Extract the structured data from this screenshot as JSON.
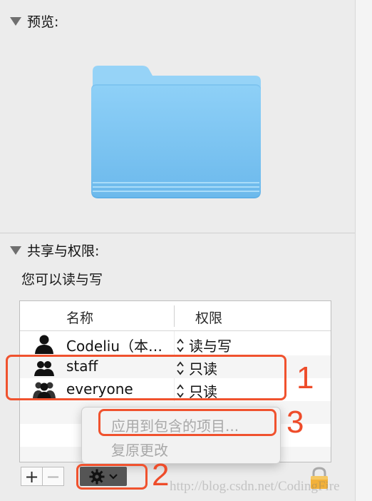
{
  "preview": {
    "header": "预览:"
  },
  "sharing": {
    "header": "共享与权限:",
    "status": "您可以读与写",
    "columns": {
      "name": "名称",
      "permission": "权限"
    },
    "rows": [
      {
        "name": "Codeliu（本…",
        "permission": "读与写",
        "icon": "user-icon"
      },
      {
        "name": "staff",
        "permission": "只读",
        "icon": "group-icon"
      },
      {
        "name": "everyone",
        "permission": "只读",
        "icon": "everyone-icon"
      }
    ]
  },
  "context_menu": {
    "items": [
      {
        "label": "应用到包含的项目...",
        "enabled": false
      },
      {
        "label": "复原更改",
        "enabled": false
      }
    ]
  },
  "toolbar": {
    "add_label": "+",
    "remove_label": "−"
  },
  "annotations": {
    "one": "1",
    "two": "2",
    "three": "3"
  },
  "watermark": "http://blog.csdn.net/CodingFire",
  "colors": {
    "annotation": "#f0522e",
    "folder": "#7fc6f2",
    "background": "#ececec"
  }
}
